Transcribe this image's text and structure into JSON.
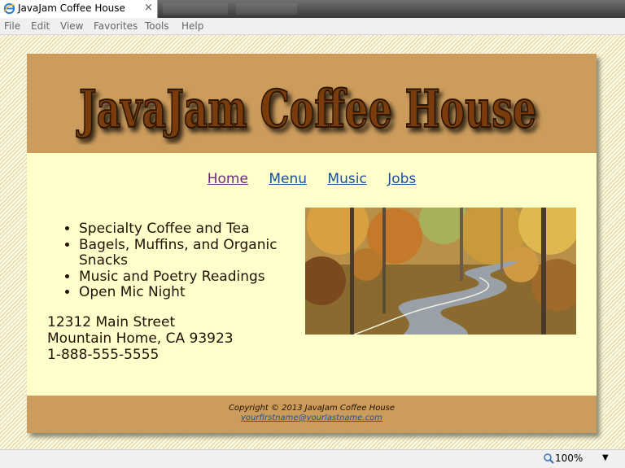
{
  "browser": {
    "tab_title": "JavaJam Coffee House",
    "tab_close": "×",
    "menu": [
      "File",
      "Edit",
      "View",
      "Favorites",
      "Tools",
      "Help"
    ],
    "zoom": "100%",
    "zoom_arrow": "▼"
  },
  "page": {
    "logo_text": "JavaJam Coffee House",
    "nav": [
      "Home",
      "Menu",
      "Music",
      "Jobs"
    ],
    "features": [
      "Specialty Coffee and Tea",
      "Bagels, Muffins, and Organic Snacks",
      "Music and Poetry Readings",
      "Open Mic Night"
    ],
    "address": [
      "12312 Main Street",
      "Mountain Home, CA 93923",
      "1-888-555-5555"
    ],
    "footer": {
      "copyright": "Copyright © 2013 JavaJam Coffee House",
      "email": "yourfirstname@yourlastname.com"
    }
  },
  "colors": {
    "header_bg": "#cc9c5c",
    "content_bg": "#ffffcc",
    "logo_text": "#7a3a10",
    "link": "#1a4fa0",
    "visited_link": "#6a2c7c"
  }
}
